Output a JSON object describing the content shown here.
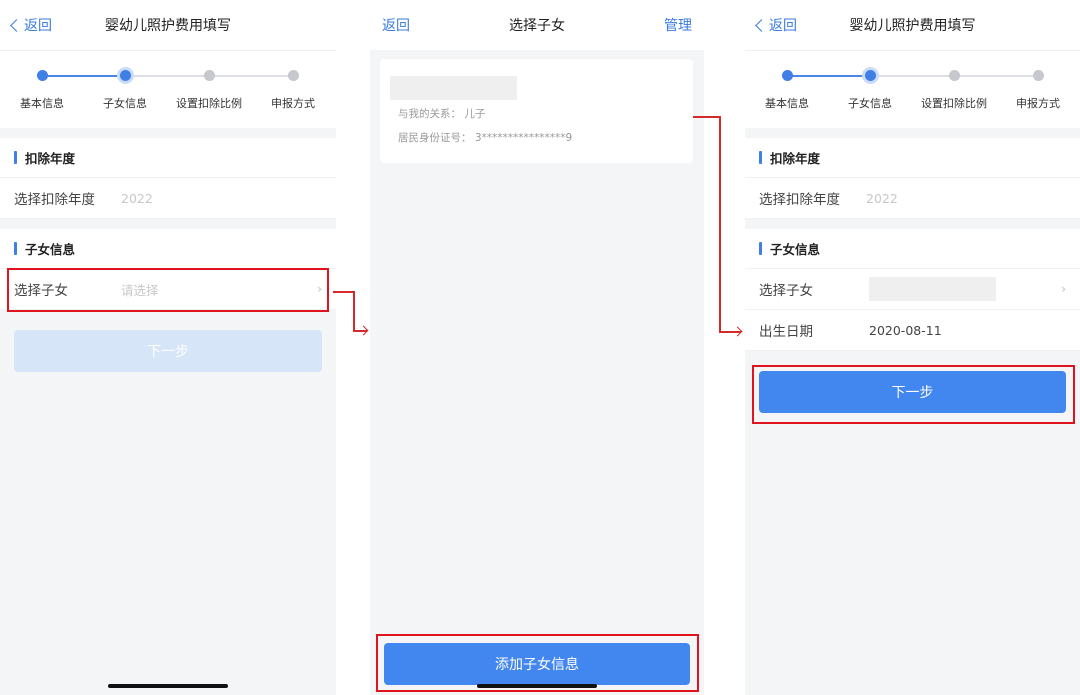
{
  "screen1": {
    "nav": {
      "back_label": "返回",
      "title": "婴幼儿照护费用填写"
    },
    "steps": [
      "基本信息",
      "子女信息",
      "设置扣除比例",
      "申报方式"
    ],
    "current_step": 2,
    "section_year": {
      "title": "扣除年度",
      "row_label": "选择扣除年度",
      "row_value": "2022"
    },
    "section_child": {
      "title": "子女信息",
      "row_label": "选择子女",
      "row_placeholder": "请选择"
    },
    "next_button": "下一步"
  },
  "screen2": {
    "nav": {
      "back_label": "返回",
      "title": "选择子女",
      "right_label": "管理"
    },
    "child_card": {
      "relation_label": "与我的关系：",
      "relation_value": "儿子",
      "id_label": "居民身份证号：",
      "id_value": "3****************9"
    },
    "add_button": "添加子女信息"
  },
  "screen3": {
    "nav": {
      "back_label": "返回",
      "title": "婴幼儿照护费用填写"
    },
    "steps": [
      "基本信息",
      "子女信息",
      "设置扣除比例",
      "申报方式"
    ],
    "current_step": 2,
    "section_year": {
      "title": "扣除年度",
      "row_label": "选择扣除年度",
      "row_value": "2022"
    },
    "section_child": {
      "title": "子女信息",
      "row_label": "选择子女",
      "birth_label": "出生日期",
      "birth_value": "2020-08-11"
    },
    "next_button": "下一步"
  },
  "colors": {
    "accent": "#3f7fe6",
    "highlight": "#e0141e",
    "button": "#4286f0",
    "button_disabled": "#d6e6f8"
  }
}
